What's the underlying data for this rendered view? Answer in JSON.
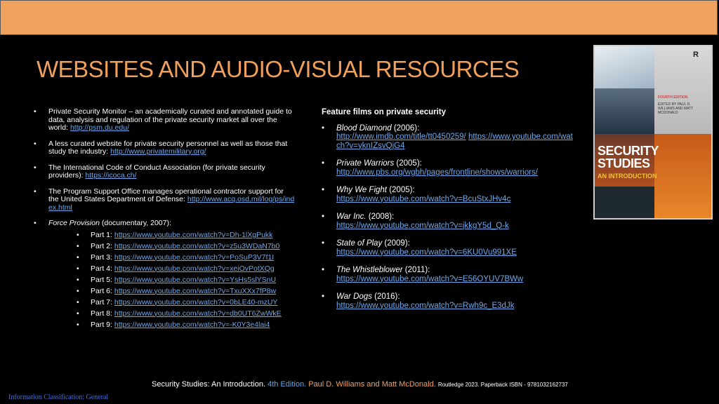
{
  "slide": {
    "title": "WEBSITES AND AUDIO-VISUAL RESOURCES",
    "classification": "Information Classification: General"
  },
  "left": {
    "items": [
      {
        "text": "Private Security Monitor – an academically curated and annotated guide to data, analysis and regulation of the private security market all over the world: ",
        "link": "http://psm.du.edu/"
      },
      {
        "text": "A less curated website for private security personnel as well as those that study the industry: ",
        "link": "http://www.privatemilitary.org/"
      },
      {
        "text": "The International Code of Conduct Association (for private security providers): ",
        "link": "https://icoca.ch/"
      },
      {
        "text": "The Program Support Office manages operational contractor support for the United States Department of Defense: ",
        "link": "http://www.acq.osd.mil/log/ps/index.html"
      }
    ],
    "force_provision": {
      "title": "Force Provision",
      "meta": " (documentary, 2007):",
      "parts": [
        {
          "label": "Part 1: ",
          "link": "https://www.youtube.com/watch?v=Dh-1lXgPukk"
        },
        {
          "label": "Part 2: ",
          "link": "https://www.youtube.com/watch?v=z5u3WDaN7b0"
        },
        {
          "label": "Part 3: ",
          "link": "https://www.youtube.com/watch?v=PoSuP3V7f1I"
        },
        {
          "label": "Part 4: ",
          "link": "https://www.youtube.com/watch?v=xeiOvPotXQg"
        },
        {
          "label": "Part 5: ",
          "link": "https://www.youtube.com/watch?v=YsHs5slYSnU"
        },
        {
          "label": "Part 6: ",
          "link": "https://www.youtube.com/watch?v=TxuXXx7fP8w"
        },
        {
          "label": "Part 7: ",
          "link": "https://www.youtube.com/watch?v=0bLE40-mzUY"
        },
        {
          "label": "Part 8: ",
          "link": "https://www.youtube.com/watch?v=db0UT6ZwWkE"
        },
        {
          "label": "Part 9: ",
          "link": "https://www.youtube.com/watch?v=-K0Y3e4lai4"
        }
      ]
    }
  },
  "right": {
    "heading": "Feature films on private security",
    "films": [
      {
        "title": "Blood Diamond",
        "year": " (2006):",
        "link1": "http://www.imdb.com/title/tt0450259/",
        "link2": "https://www.youtube.com/watch?v=yknIZsvQjG4"
      },
      {
        "title": "Private Warriors",
        "year": " (2005):",
        "link1": "http://www.pbs.org/wgbh/pages/frontline/shows/warriors/",
        "link2": ""
      },
      {
        "title": "Why We Fight",
        "year": " (2005):",
        "link1": "https://www.youtube.com/watch?v=BcuStxJHv4c",
        "link2": ""
      },
      {
        "title": "War Inc.",
        "year": " (2008):",
        "link1": "https://www.youtube.com/watch?v=jkkgY5d_Q-k",
        "link2": ""
      },
      {
        "title": "State of Play",
        "year": " (2009):",
        "link1": "https://www.youtube.com/watch?v=6KU0Vu991XE",
        "link2": ""
      },
      {
        "title": "The Whistleblower",
        "year": " (2011):",
        "link1": "https://www.youtube.com/watch?v=E56OYUV7BWw",
        "link2": ""
      },
      {
        "title": "War Dogs",
        "year": " (2016):",
        "link1": "https://www.youtube.com/watch?v=Rwh9c_E3dJk",
        "link2": ""
      }
    ]
  },
  "book": {
    "title_line1": "SECURITY",
    "title_line2": "STUDIES",
    "subtitle": "AN INTRODUCTION",
    "edition": "FOURTH EDITION",
    "editors": "EDITED BY PAUL D. WILLIAMS AND MATT MCDONALD",
    "publisher_logo": "R"
  },
  "footer": {
    "part1": "Security Studies: An Introduction. ",
    "part2": "4th Edition. ",
    "part3": "Paul D. Williams and Matt McDonald. ",
    "part4": "Routledge 2023. Paperback ISBN - 9781032162737"
  }
}
